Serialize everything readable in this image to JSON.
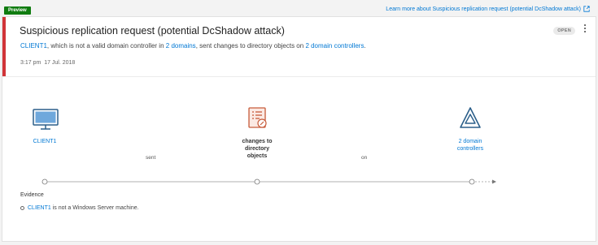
{
  "top": {
    "badge": "Preview",
    "learn_more": "Learn more about Suspicious replication request (potential DcShadow attack)"
  },
  "alert": {
    "title": "Suspicious replication request (potential DcShadow attack)",
    "status": "OPEN",
    "description": {
      "entity": "CLIENT1",
      "part1": ", which is not a valid domain controller in ",
      "domains_link": "2 domains",
      "part2": ", sent changes to directory objects on ",
      "dc_link": "2 domain controllers",
      "part3": "."
    },
    "time": "3:17 pm",
    "date": "17 Jul. 2018"
  },
  "graph": {
    "nodes": [
      {
        "label": "CLIENT1",
        "icon": "monitor-icon"
      },
      {
        "label_lines": [
          "changes to",
          "directory",
          "objects"
        ],
        "icon": "document-icon"
      },
      {
        "label_lines": [
          "2 domain",
          "controllers"
        ],
        "icon": "domain-controller-triangle-icon"
      }
    ],
    "edges": [
      "sent",
      "on"
    ]
  },
  "evidence": {
    "title": "Evidence",
    "items": [
      {
        "entity": "CLIENT1",
        "text": " is not a Windows Server machine."
      }
    ]
  },
  "colors": {
    "accent": "#0078d4",
    "severity": "#d13438",
    "preview": "#107c10",
    "document_icon": "#c75b3a"
  }
}
